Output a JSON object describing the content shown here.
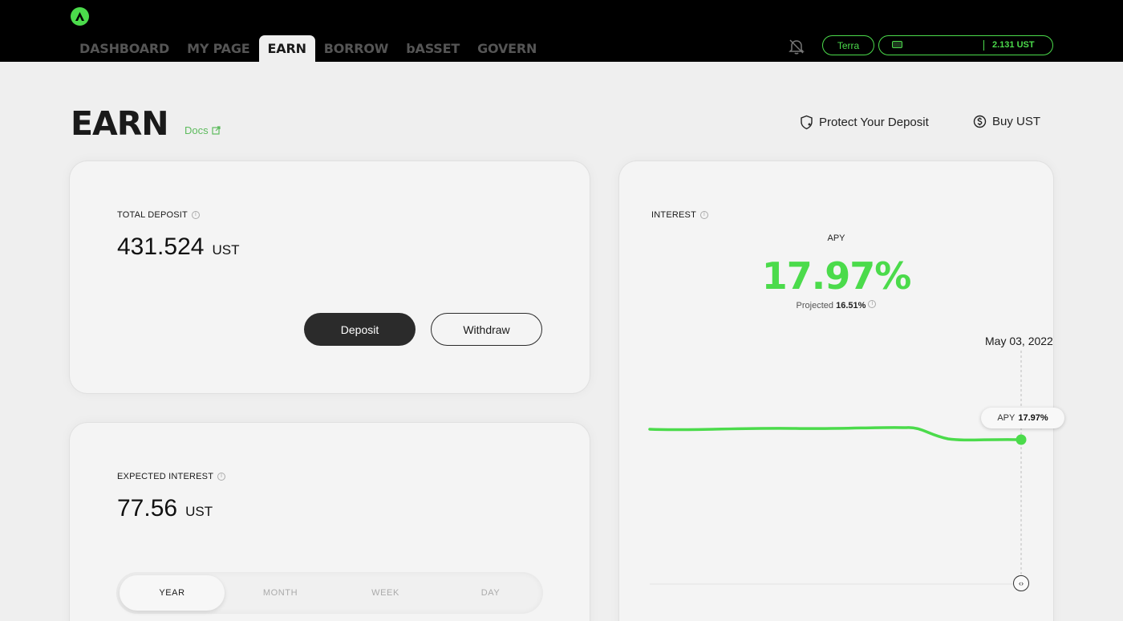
{
  "nav": {
    "items": [
      {
        "label": "DASHBOARD",
        "active": false
      },
      {
        "label": "MY PAGE",
        "active": false
      },
      {
        "label": "EARN",
        "active": true
      },
      {
        "label": "BORROW",
        "active": false
      },
      {
        "label": "bASSET",
        "active": false
      },
      {
        "label": "GOVERN",
        "active": false
      }
    ],
    "network": "Terra",
    "wallet_balance": "2.131 UST",
    "accent": "#4bdb4b"
  },
  "page": {
    "title": "EARN",
    "docs_label": "Docs",
    "protect_label": "Protect Your Deposit",
    "buy_label": "Buy UST"
  },
  "deposit": {
    "label": "TOTAL DEPOSIT",
    "value": "431.524",
    "unit": "UST",
    "deposit_button": "Deposit",
    "withdraw_button": "Withdraw"
  },
  "expected": {
    "label": "EXPECTED INTEREST",
    "value": "77.56",
    "unit": "UST",
    "tabs": [
      {
        "label": "YEAR",
        "active": true
      },
      {
        "label": "MONTH",
        "active": false
      },
      {
        "label": "WEEK",
        "active": false
      },
      {
        "label": "DAY",
        "active": false
      }
    ]
  },
  "interest": {
    "label": "INTEREST",
    "apy_label": "APY",
    "apy_value": "17.97%",
    "projected_label": "Projected",
    "projected_value": "16.51%",
    "chart_date": "May 03, 2022",
    "tooltip_label": "APY",
    "tooltip_value": "17.97%"
  }
}
